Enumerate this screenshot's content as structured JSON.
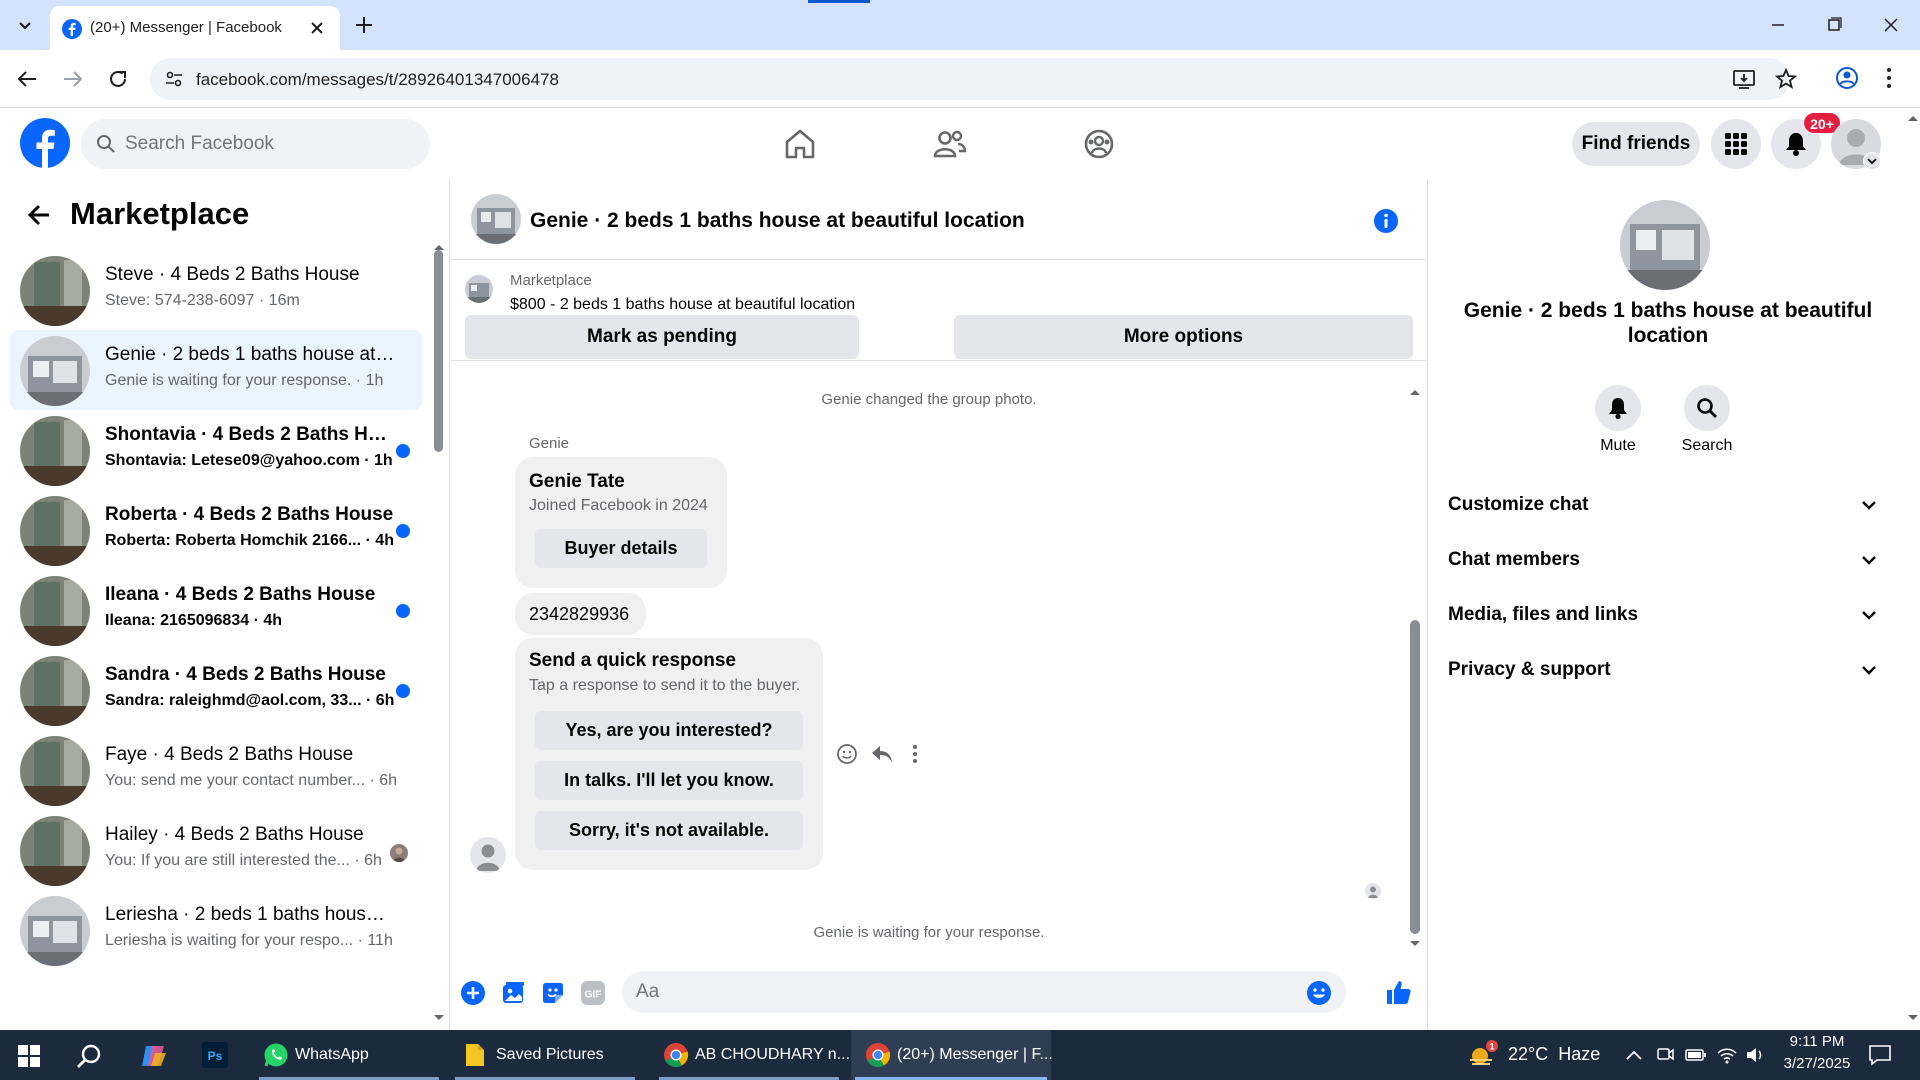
{
  "browser": {
    "tab_title": "(20+) Messenger | Facebook",
    "url": "facebook.com/messages/t/28926401347006478"
  },
  "fb": {
    "search_placeholder": "Search Facebook",
    "find_friends": "Find friends",
    "notif_badge": "20+"
  },
  "sidebar": {
    "title": "Marketplace",
    "conversations": [
      {
        "name": "Steve · 4 Beds 2 Baths House",
        "snippet": "Steve: 574-238-6097 · 16m",
        "unread": false,
        "active": false
      },
      {
        "name": "Genie · 2 beds 1 baths house at ...",
        "snippet": "Genie is waiting for your response. · 1h",
        "unread": false,
        "active": true
      },
      {
        "name": "Shontavia · 4 Beds 2 Baths Ho...",
        "snippet": "Shontavia: Letese09@yahoo.com · 1h",
        "unread": true,
        "active": false
      },
      {
        "name": "Roberta · 4 Beds 2 Baths House",
        "snippet": "Roberta: Roberta Homchik 2166... · 4h",
        "unread": true,
        "active": false
      },
      {
        "name": "Ileana · 4 Beds 2 Baths House",
        "snippet": "Ileana: 2165096834 · 4h",
        "unread": true,
        "active": false
      },
      {
        "name": "Sandra · 4 Beds 2 Baths House",
        "snippet": "Sandra: raleighmd@aol.com, 33... · 6h",
        "unread": true,
        "active": false
      },
      {
        "name": "Faye · 4 Beds 2 Baths House",
        "snippet": "You: send me your contact number... · 6h",
        "unread": false,
        "active": false
      },
      {
        "name": "Hailey · 4 Beds 2 Baths House",
        "snippet": "You: If you are still interested the... · 6h",
        "unread": false,
        "active": false
      },
      {
        "name": "Leriesha · 2 beds 1 baths house ...",
        "snippet": "Leriesha is waiting for your respo... · 11h",
        "unread": false,
        "active": false
      }
    ]
  },
  "chat": {
    "title": "Genie · 2 beds 1 baths house at beautiful location",
    "listing_label": "Marketplace",
    "listing_detail": "$800 - 2 beds 1 baths house at beautiful location",
    "mark_pending": "Mark as pending",
    "more_options": "More options",
    "system_photo": "Genie changed the group photo.",
    "sender": "Genie",
    "profile_name": "Genie Tate",
    "profile_joined": "Joined Facebook in 2024",
    "buyer_details": "Buyer details",
    "phone": "2342829936",
    "quick_title": "Send a quick response",
    "quick_sub": "Tap a response to send it to the buyer.",
    "quick_options": [
      "Yes, are you interested?",
      "In talks. I'll let you know.",
      "Sorry, it's not available."
    ],
    "waiting": "Genie is waiting for your response.",
    "composer_placeholder": "Aa"
  },
  "info": {
    "title": "Genie · 2 beds 1 baths house at beautiful location",
    "mute": "Mute",
    "search": "Search",
    "sections": [
      "Customize chat",
      "Chat members",
      "Media, files and links",
      "Privacy & support"
    ]
  },
  "taskbar": {
    "whatsapp": "WhatsApp",
    "saved_pictures": "Saved Pictures",
    "chrome1": "AB CHOUDHARY n...",
    "chrome2": "(20+) Messenger | F...",
    "weather": "22°C  Haze",
    "time": "9:11 PM",
    "date": "3/27/2025"
  },
  "colors": {
    "fb_blue": "#0866ff",
    "tab_strip": "#d3e3fd",
    "active_conv": "#ebf5ff",
    "badge_red": "#e41e3f",
    "taskbar": "#1c2a3d"
  }
}
